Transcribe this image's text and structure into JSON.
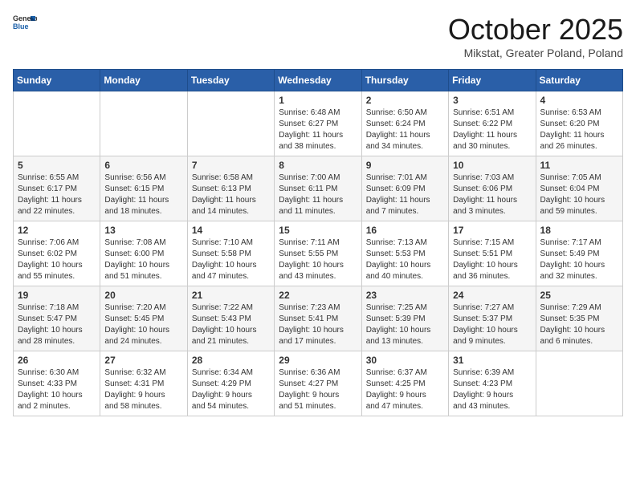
{
  "header": {
    "logo_general": "General",
    "logo_blue": "Blue",
    "month": "October 2025",
    "location": "Mikstat, Greater Poland, Poland"
  },
  "days_of_week": [
    "Sunday",
    "Monday",
    "Tuesday",
    "Wednesday",
    "Thursday",
    "Friday",
    "Saturday"
  ],
  "weeks": [
    [
      {
        "day": "",
        "info": ""
      },
      {
        "day": "",
        "info": ""
      },
      {
        "day": "",
        "info": ""
      },
      {
        "day": "1",
        "info": "Sunrise: 6:48 AM\nSunset: 6:27 PM\nDaylight: 11 hours\nand 38 minutes."
      },
      {
        "day": "2",
        "info": "Sunrise: 6:50 AM\nSunset: 6:24 PM\nDaylight: 11 hours\nand 34 minutes."
      },
      {
        "day": "3",
        "info": "Sunrise: 6:51 AM\nSunset: 6:22 PM\nDaylight: 11 hours\nand 30 minutes."
      },
      {
        "day": "4",
        "info": "Sunrise: 6:53 AM\nSunset: 6:20 PM\nDaylight: 11 hours\nand 26 minutes."
      }
    ],
    [
      {
        "day": "5",
        "info": "Sunrise: 6:55 AM\nSunset: 6:17 PM\nDaylight: 11 hours\nand 22 minutes."
      },
      {
        "day": "6",
        "info": "Sunrise: 6:56 AM\nSunset: 6:15 PM\nDaylight: 11 hours\nand 18 minutes."
      },
      {
        "day": "7",
        "info": "Sunrise: 6:58 AM\nSunset: 6:13 PM\nDaylight: 11 hours\nand 14 minutes."
      },
      {
        "day": "8",
        "info": "Sunrise: 7:00 AM\nSunset: 6:11 PM\nDaylight: 11 hours\nand 11 minutes."
      },
      {
        "day": "9",
        "info": "Sunrise: 7:01 AM\nSunset: 6:09 PM\nDaylight: 11 hours\nand 7 minutes."
      },
      {
        "day": "10",
        "info": "Sunrise: 7:03 AM\nSunset: 6:06 PM\nDaylight: 11 hours\nand 3 minutes."
      },
      {
        "day": "11",
        "info": "Sunrise: 7:05 AM\nSunset: 6:04 PM\nDaylight: 10 hours\nand 59 minutes."
      }
    ],
    [
      {
        "day": "12",
        "info": "Sunrise: 7:06 AM\nSunset: 6:02 PM\nDaylight: 10 hours\nand 55 minutes."
      },
      {
        "day": "13",
        "info": "Sunrise: 7:08 AM\nSunset: 6:00 PM\nDaylight: 10 hours\nand 51 minutes."
      },
      {
        "day": "14",
        "info": "Sunrise: 7:10 AM\nSunset: 5:58 PM\nDaylight: 10 hours\nand 47 minutes."
      },
      {
        "day": "15",
        "info": "Sunrise: 7:11 AM\nSunset: 5:55 PM\nDaylight: 10 hours\nand 43 minutes."
      },
      {
        "day": "16",
        "info": "Sunrise: 7:13 AM\nSunset: 5:53 PM\nDaylight: 10 hours\nand 40 minutes."
      },
      {
        "day": "17",
        "info": "Sunrise: 7:15 AM\nSunset: 5:51 PM\nDaylight: 10 hours\nand 36 minutes."
      },
      {
        "day": "18",
        "info": "Sunrise: 7:17 AM\nSunset: 5:49 PM\nDaylight: 10 hours\nand 32 minutes."
      }
    ],
    [
      {
        "day": "19",
        "info": "Sunrise: 7:18 AM\nSunset: 5:47 PM\nDaylight: 10 hours\nand 28 minutes."
      },
      {
        "day": "20",
        "info": "Sunrise: 7:20 AM\nSunset: 5:45 PM\nDaylight: 10 hours\nand 24 minutes."
      },
      {
        "day": "21",
        "info": "Sunrise: 7:22 AM\nSunset: 5:43 PM\nDaylight: 10 hours\nand 21 minutes."
      },
      {
        "day": "22",
        "info": "Sunrise: 7:23 AM\nSunset: 5:41 PM\nDaylight: 10 hours\nand 17 minutes."
      },
      {
        "day": "23",
        "info": "Sunrise: 7:25 AM\nSunset: 5:39 PM\nDaylight: 10 hours\nand 13 minutes."
      },
      {
        "day": "24",
        "info": "Sunrise: 7:27 AM\nSunset: 5:37 PM\nDaylight: 10 hours\nand 9 minutes."
      },
      {
        "day": "25",
        "info": "Sunrise: 7:29 AM\nSunset: 5:35 PM\nDaylight: 10 hours\nand 6 minutes."
      }
    ],
    [
      {
        "day": "26",
        "info": "Sunrise: 6:30 AM\nSunset: 4:33 PM\nDaylight: 10 hours\nand 2 minutes."
      },
      {
        "day": "27",
        "info": "Sunrise: 6:32 AM\nSunset: 4:31 PM\nDaylight: 9 hours\nand 58 minutes."
      },
      {
        "day": "28",
        "info": "Sunrise: 6:34 AM\nSunset: 4:29 PM\nDaylight: 9 hours\nand 54 minutes."
      },
      {
        "day": "29",
        "info": "Sunrise: 6:36 AM\nSunset: 4:27 PM\nDaylight: 9 hours\nand 51 minutes."
      },
      {
        "day": "30",
        "info": "Sunrise: 6:37 AM\nSunset: 4:25 PM\nDaylight: 9 hours\nand 47 minutes."
      },
      {
        "day": "31",
        "info": "Sunrise: 6:39 AM\nSunset: 4:23 PM\nDaylight: 9 hours\nand 43 minutes."
      },
      {
        "day": "",
        "info": ""
      }
    ]
  ]
}
